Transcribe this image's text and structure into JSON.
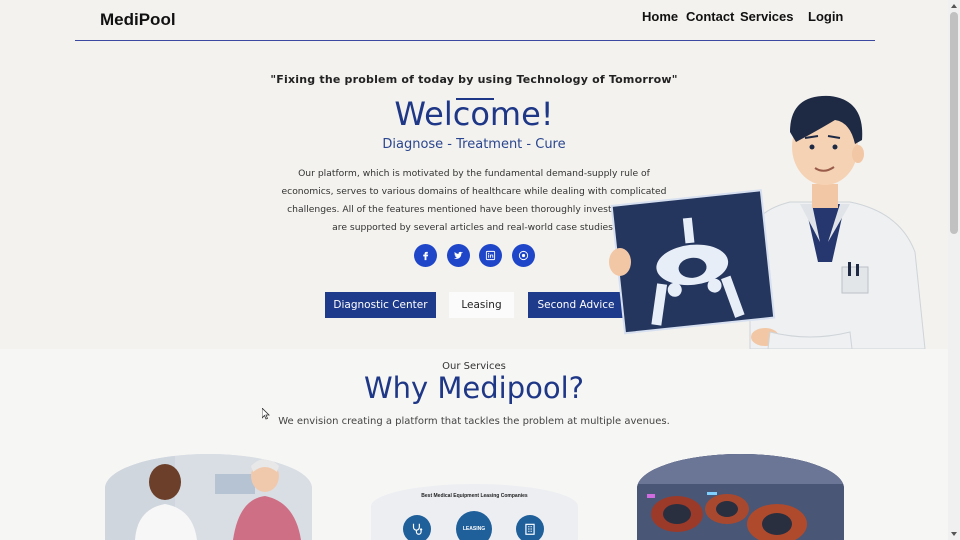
{
  "header": {
    "brand": "MediPool",
    "nav": [
      "Home",
      "Contact",
      "Services",
      "Login"
    ]
  },
  "hero": {
    "quote": "\"Fixing the problem of today by using Technology of Tomorrow\"",
    "title": "Welcome!",
    "tagline": "Diagnose - Treatment - Cure",
    "description": "Our platform, which is motivated by the fundamental demand-supply rule of economics, serves to various domains of healthcare while dealing with complicated challenges. All of the features mentioned have been thoroughly investigated and are supported by several articles and real-world case studies.",
    "social_icons": [
      "facebook-icon",
      "twitter-icon",
      "linkedin-icon",
      "github-icon"
    ],
    "buttons": [
      "Diagnostic Center",
      "Leasing",
      "Second Advice"
    ]
  },
  "services": {
    "eyebrow": "Our Services",
    "title": "Why Medipool?",
    "subtitle": "We envision creating a platform that tackles the problem at multiple avenues.",
    "infographic_title": "Best Medical Equipment Leasing Companies",
    "infographic_center": "LEASING"
  },
  "colors": {
    "accent": "#1f3787",
    "button": "#1e3a8a",
    "social": "#1f45c9",
    "background": "#f3f2ee"
  }
}
